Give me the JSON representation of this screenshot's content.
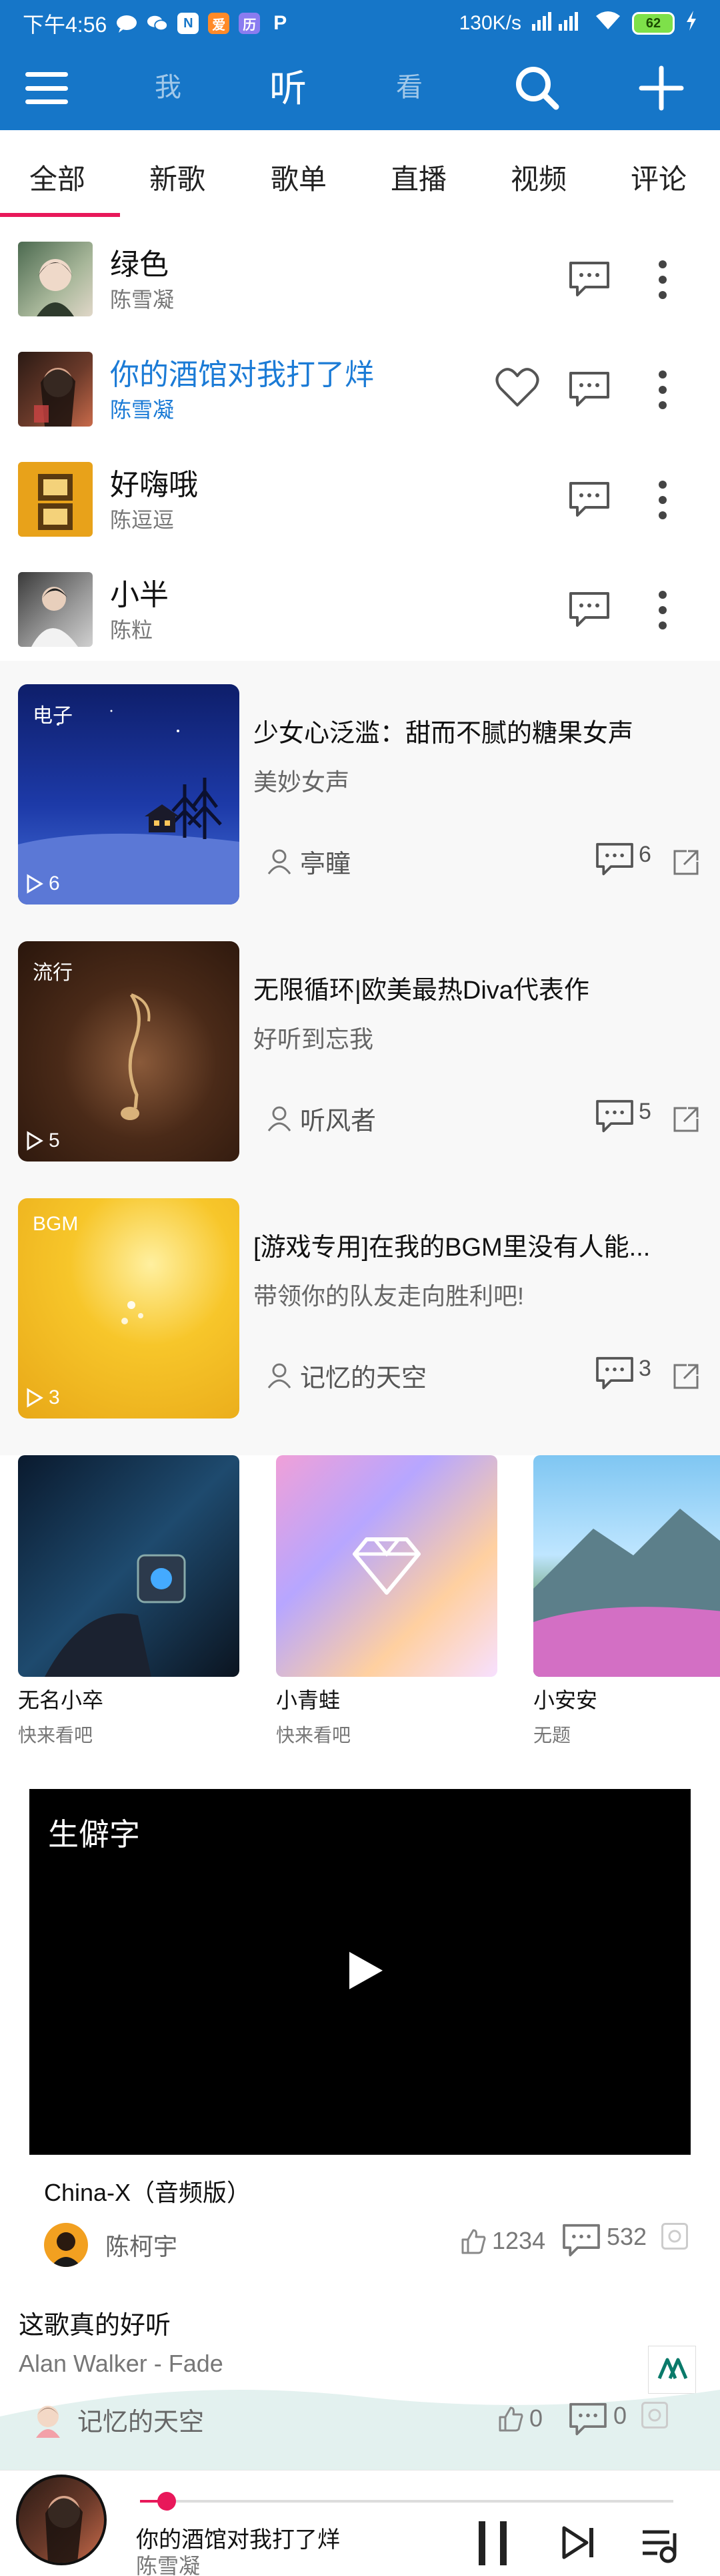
{
  "status": {
    "time": "下午4:56",
    "net_speed": "130K/s",
    "battery": "62",
    "icons": [
      "chat-icon",
      "wechat-icon",
      "n-app-icon",
      "orange-app-icon",
      "calendar-icon",
      "p-app-icon",
      "signal-icon",
      "wifi-icon",
      "charging-icon"
    ]
  },
  "header": {
    "tabs": [
      "我",
      "听",
      "看"
    ],
    "active_tab": "听",
    "bg_color": "#1676c8"
  },
  "categories": {
    "items": [
      "全部",
      "新歌",
      "歌单",
      "直播",
      "视频",
      "评论"
    ],
    "active": "全部",
    "accent": "#e8185a"
  },
  "songs": [
    {
      "title": "绿色",
      "artist": "陈雪凝",
      "playing": false
    },
    {
      "title": "你的酒馆对我打了烊",
      "artist": "陈雪凝",
      "playing": true
    },
    {
      "title": "好嗨哦",
      "artist": "陈逗逗",
      "playing": false
    },
    {
      "title": "小半",
      "artist": "陈粒",
      "playing": false
    }
  ],
  "playlists": [
    {
      "tag": "电子",
      "count": "6",
      "title": "少女心泛滥：甜而不腻的糖果女声",
      "desc": "美妙女声",
      "user": "亭瞳",
      "comments": "6"
    },
    {
      "tag": "流行",
      "count": "5",
      "title": "无限循环|欧美最热Diva代表作",
      "desc": "好听到忘我",
      "user": "听风者",
      "comments": "5"
    },
    {
      "tag": "BGM",
      "count": "3",
      "title": "[游戏专用]在我的BGM里没有人能...",
      "desc": "带领你的队友走向胜利吧!",
      "user": "记忆的天空",
      "comments": "3"
    }
  ],
  "cards": [
    {
      "name": "无名小卒",
      "sub": "快来看吧"
    },
    {
      "name": "小青蛙",
      "sub": "快来看吧"
    },
    {
      "name": "小安安",
      "sub": "无题"
    }
  ],
  "video_post": {
    "video_title": "生僻字",
    "title": "China-X（音频版）",
    "user": "陈柯宇",
    "likes": "1234",
    "comments": "532"
  },
  "comment_post": {
    "text": "这歌真的好听",
    "song": "Alan Walker - Fade",
    "user": "记忆的天空",
    "likes": "0",
    "comments": "0"
  },
  "player": {
    "title": "你的酒馆对我打了烊",
    "artist": "陈雪凝",
    "progress": 0.05
  }
}
